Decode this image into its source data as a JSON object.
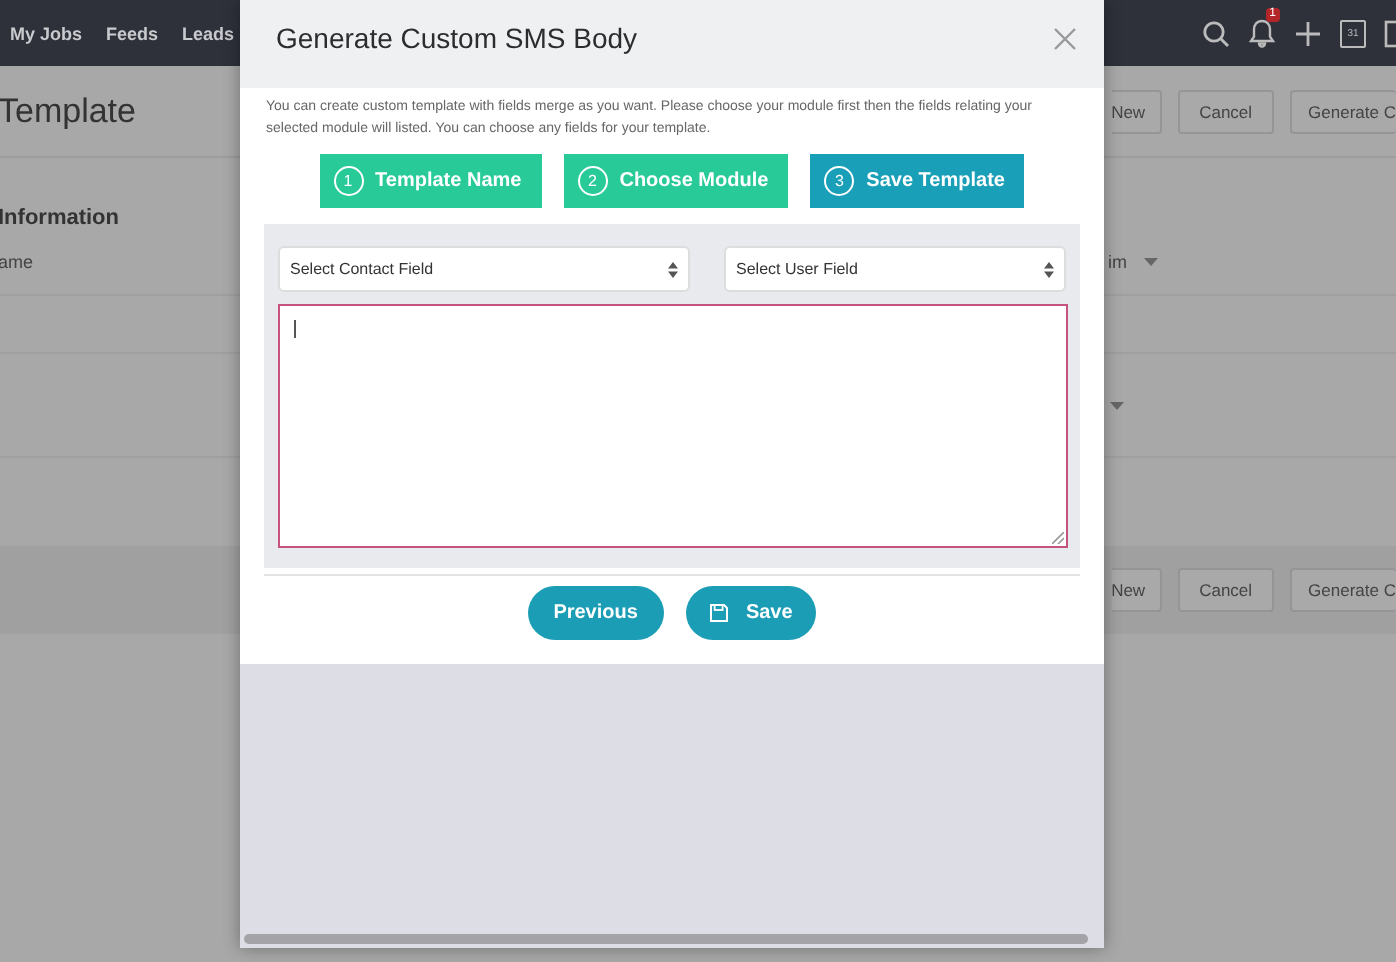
{
  "nav": {
    "items": [
      "My Jobs",
      "Feeds",
      "Leads"
    ],
    "notification_badge": "1",
    "calendar_day": "31"
  },
  "page": {
    "title": "Template",
    "top_buttons": [
      "New",
      "Cancel",
      "Generate C"
    ],
    "section_title": "Information",
    "left_label": "ame",
    "right_label": "im",
    "bottom_buttons": [
      "New",
      "Cancel",
      "Generate C"
    ]
  },
  "dialog": {
    "title": "Generate Custom SMS Body",
    "description": "You can create custom template with fields merge as you want. Please choose your module first then the fields relating your selected module will listed. You can choose any fields for your template.",
    "steps": [
      {
        "number": "1",
        "label": "Template Name",
        "selected": false
      },
      {
        "number": "2",
        "label": "Choose Module",
        "selected": false
      },
      {
        "number": "3",
        "label": "Save Template",
        "selected": true
      }
    ],
    "selects": [
      {
        "placeholder": "Select Contact Field"
      },
      {
        "placeholder": "Select User Field"
      }
    ],
    "buttons": [
      {
        "kind": "plain",
        "label": "Previous"
      },
      {
        "kind": "save",
        "label": "Save"
      }
    ]
  }
}
